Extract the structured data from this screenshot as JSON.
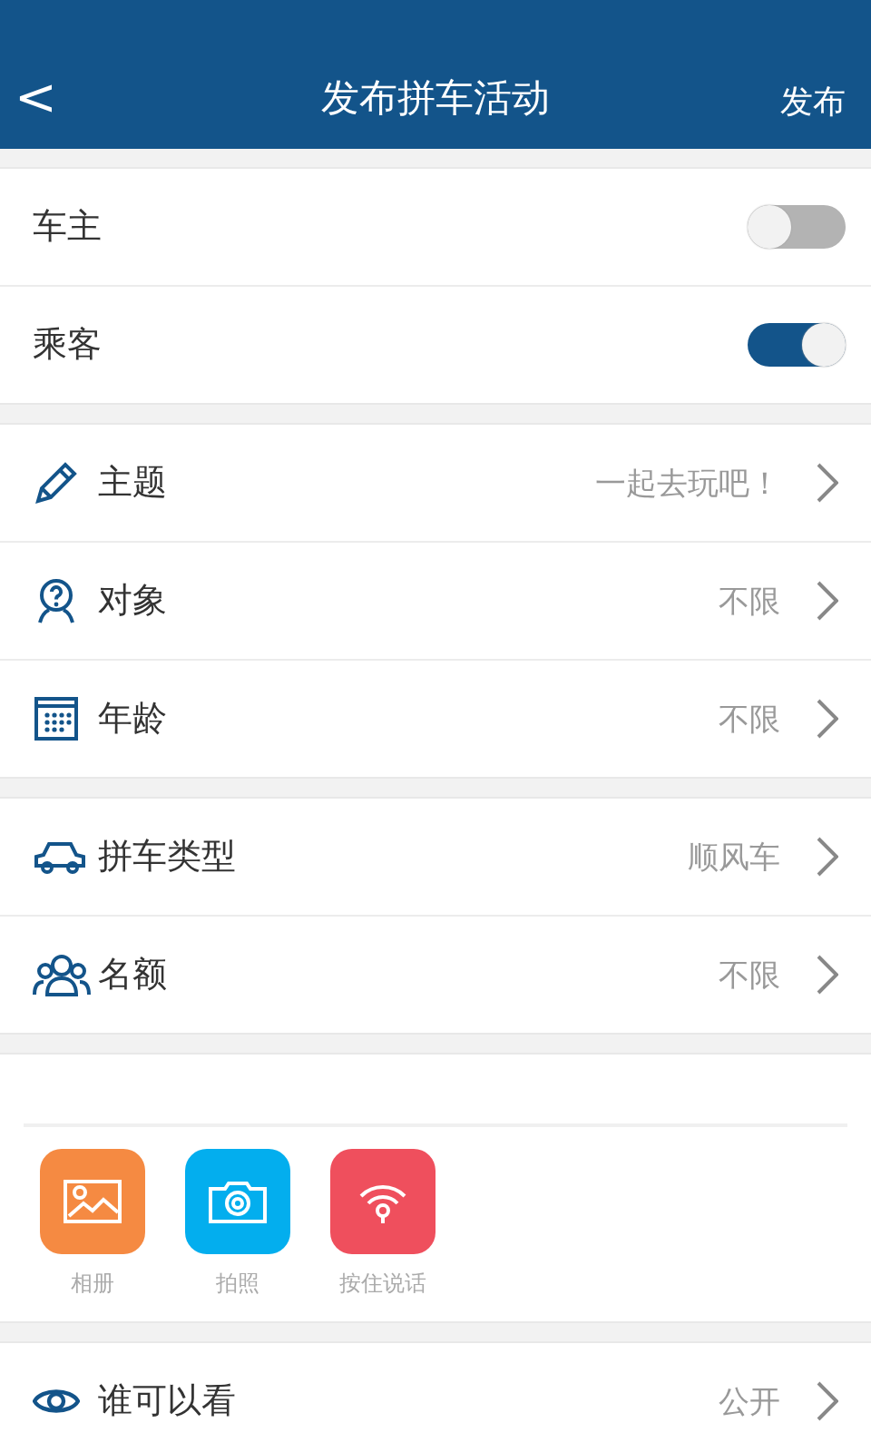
{
  "header": {
    "back": "<",
    "title": "发布拼车活动",
    "action": "发布"
  },
  "roles": [
    {
      "label": "车主",
      "on": false
    },
    {
      "label": "乘客",
      "on": true
    }
  ],
  "groups": [
    [
      {
        "kind": "pencil",
        "label": "主题",
        "value": "一起去玩吧！"
      },
      {
        "kind": "person",
        "label": "对象",
        "value": "不限"
      },
      {
        "kind": "calendar",
        "label": "年龄",
        "value": "不限"
      }
    ],
    [
      {
        "kind": "car",
        "label": "拼车类型",
        "value": "顺风车"
      },
      {
        "kind": "group",
        "label": "名额",
        "value": "不限"
      }
    ]
  ],
  "media": [
    {
      "kind": "album",
      "label": "相册",
      "color": "#f58a42"
    },
    {
      "kind": "camera",
      "label": "拍照",
      "color": "#03aeee"
    },
    {
      "kind": "voice",
      "label": "按住说话",
      "color": "#ef4f5d"
    }
  ],
  "visibility": {
    "kind": "eye",
    "label": "谁可以看",
    "value": "公开"
  }
}
